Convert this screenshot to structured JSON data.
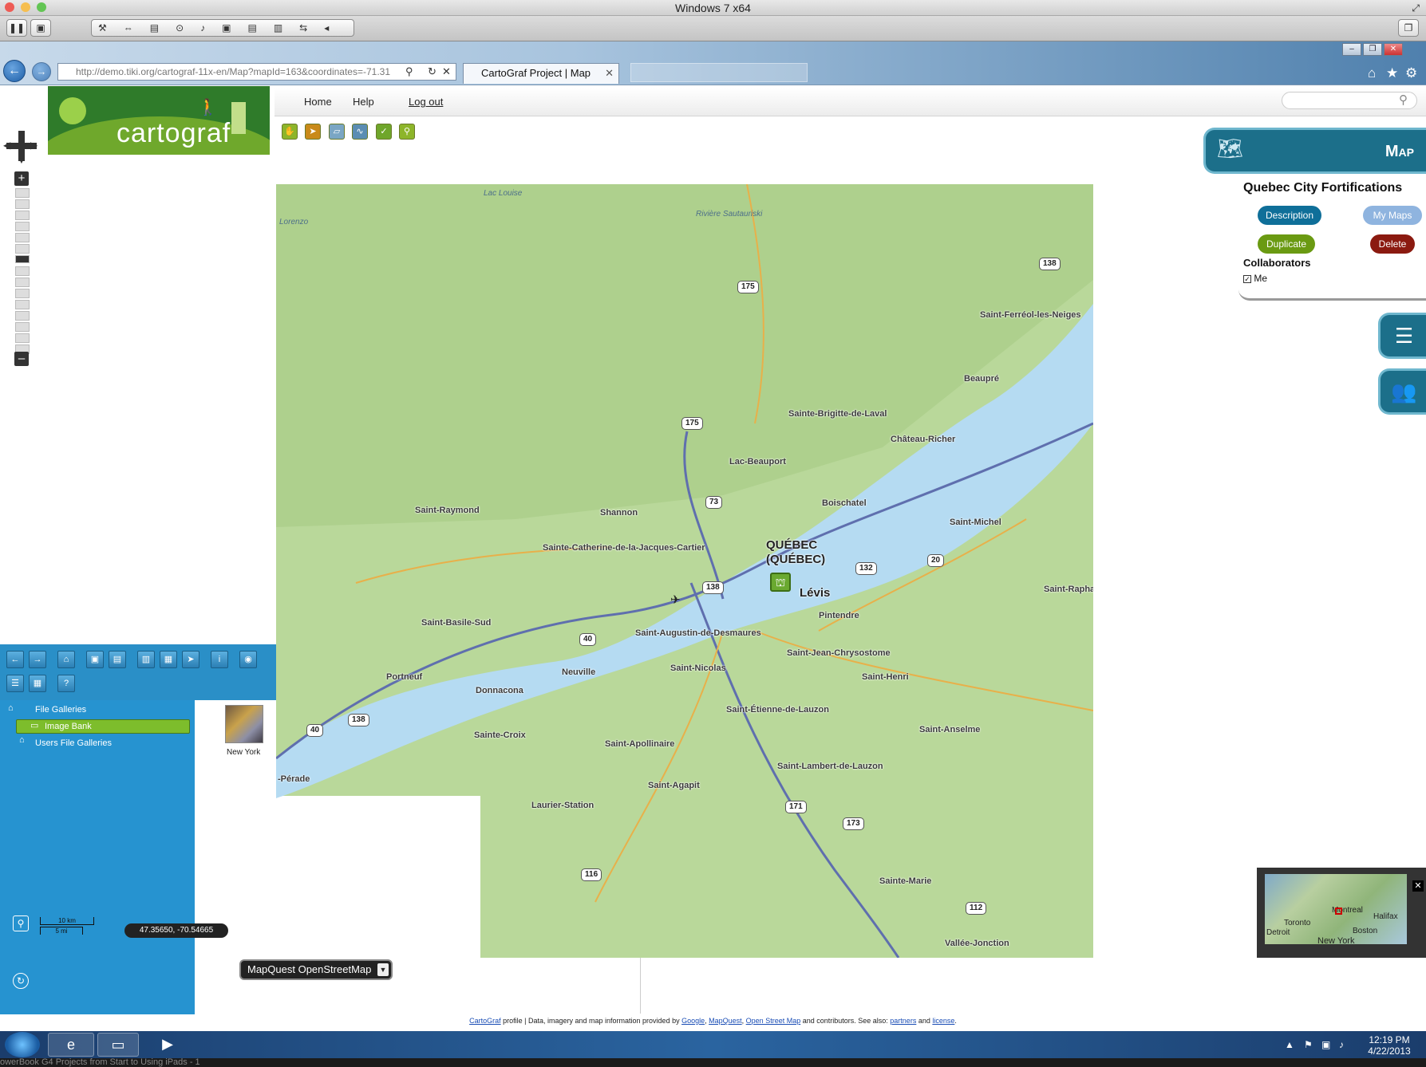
{
  "vm": {
    "title": "Windows 7 x64"
  },
  "browser": {
    "address": "http://demo.tiki.org/cartograf-11x-en/Map?mapId=163&coordinates=-71.31",
    "tab_title": "CartoGraf Project | Map"
  },
  "site": {
    "logo_text": "cartograf",
    "menu": [
      "Home",
      "Help",
      "Log out"
    ]
  },
  "panel": {
    "header": "Map",
    "map_title": "Quebec City Fortifications",
    "buttons": {
      "description": "Description",
      "my_maps": "My Maps",
      "duplicate": "Duplicate",
      "delete": "Delete"
    },
    "collaborators_label": "Collaborators",
    "collaborator_me": "Me"
  },
  "map": {
    "water_labels": [
      "Lac Louise",
      "Rivière Sautauriski"
    ],
    "cities": [
      "Saint-Ferréol-les-Neiges",
      "Beaupré",
      "Sainte-Brigitte-de-Laval",
      "Château-Richer",
      "Lac-Beauport",
      "Saint-Raymond",
      "Shannon",
      "Boischatel",
      "Saint-Michel",
      "Sainte-Catherine-de-la-Jacques-Cartier",
      "Lévis",
      "Saint-Rapha",
      "Saint-Basile-Sud",
      "Saint-Augustin-de-Desmaures",
      "Pintendre",
      "Saint-Jean-Chrysostome",
      "Neuville",
      "Saint-Nicolas",
      "Saint-Henri",
      "Portneuf",
      "Donnacona",
      "Saint-Étienne-de-Lauzon",
      "Sainte-Croix",
      "Saint-Anselme",
      "Saint-Apollinaire",
      "Saint-Lambert-de-Lauzon",
      "Saint-Agapit",
      "Laurier-Station",
      "Sainte-Marie",
      "Vallée-Jonction",
      "-Pérade",
      "Lorenzo"
    ],
    "capital": [
      "QUÉBEC",
      "(QUÉBEC)"
    ],
    "shields": [
      "138",
      "175",
      "175",
      "73",
      "132",
      "20",
      "138",
      "40",
      "138",
      "40",
      "171",
      "173",
      "116",
      "112"
    ]
  },
  "gallery": {
    "tree": [
      "File Galleries",
      "Image Bank",
      "Users File Galleries"
    ],
    "thumb_label": "New York"
  },
  "scale": {
    "km": "10 km",
    "mi": "5 mi"
  },
  "coords": "47.35650, -70.54665",
  "layer": "MapQuest OpenStreetMap",
  "overview": {
    "labels": [
      "Toronto",
      "Montreal",
      "Halifax",
      "Detroit",
      "Boston",
      "New York"
    ]
  },
  "footer": {
    "l1": "CartoGraf",
    "t1": " profile | Data, imagery and map information provided by ",
    "l2": "Google",
    "t2": ", ",
    "l3": "MapQuest",
    "t3": ", ",
    "l4": "Open Street Map",
    "t4": " and contributors. See also: ",
    "l5": "partners",
    "t5": " and ",
    "l6": "license",
    "t6": "."
  },
  "taskbar": {
    "time": "12:19 PM",
    "date": "4/22/2013",
    "bottom_strip": "owerBook G4                           Projects from Start to          Using iPads - 1"
  },
  "colors": {
    "teal": "#1c6f8a",
    "blue_button": "#0f6f99",
    "my_maps": "#8fb4df",
    "duplicate": "#6a9a12",
    "delete": "#8b1a10",
    "land": "#b9d89a",
    "water": "#b5dbf2"
  }
}
